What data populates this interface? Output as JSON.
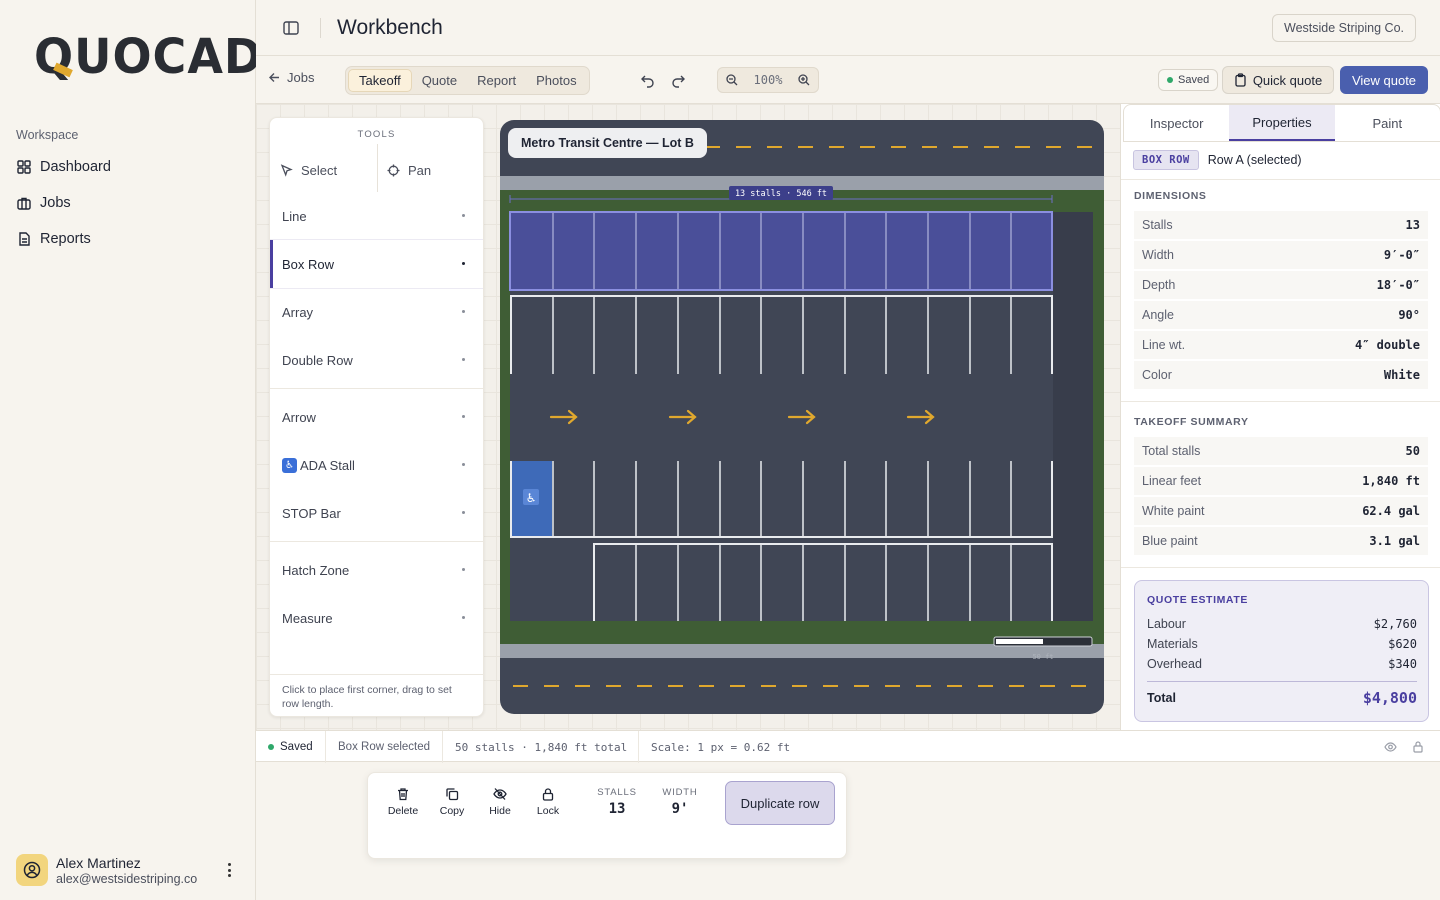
{
  "brand": {
    "logo": "QUOCAD"
  },
  "sidebar": {
    "section_label": "Workspace",
    "items": [
      {
        "label": "Dashboard",
        "icon": "grid-icon"
      },
      {
        "label": "Jobs",
        "icon": "briefcase-icon"
      },
      {
        "label": "Reports",
        "icon": "document-icon"
      }
    ],
    "user": {
      "name": "Alex Martinez",
      "email": "alex@westsidestriping.co"
    }
  },
  "header": {
    "title": "Workbench",
    "company": "Westside Striping Co."
  },
  "toolbar": {
    "back_label": "Jobs",
    "tabs": [
      {
        "label": "Takeoff",
        "active": true
      },
      {
        "label": "Quote",
        "active": false
      },
      {
        "label": "Report",
        "active": false
      },
      {
        "label": "Photos",
        "active": false
      }
    ],
    "zoom": "100%",
    "saved": "Saved",
    "quick_quote": "Quick quote",
    "view_quote": "View quote"
  },
  "tools": {
    "title": "TOOLS",
    "select": "Select",
    "pan": "Pan",
    "items": [
      "Line",
      "Box Row",
      "Array",
      "Double Row",
      "Arrow",
      "ADA Stall",
      "STOP Bar",
      "Hatch Zone",
      "Measure"
    ],
    "active": "Box Row",
    "hint": "Click to place first corner, drag to set row length."
  },
  "canvas": {
    "lot_name": "Metro Transit Centre — Lot B",
    "dimension_label": "13 stalls · 546 ft",
    "scale_label": "50 ft",
    "colors": {
      "asphalt": "#404655",
      "grass": "#3f5d35",
      "curb": "#9aa0aa",
      "lane": "#e0a82e",
      "selection": "#4a4f99",
      "ada": "#3e6ab8"
    }
  },
  "inspector": {
    "tabs": [
      {
        "label": "Inspector",
        "active": false
      },
      {
        "label": "Properties",
        "active": true
      },
      {
        "label": "Paint",
        "active": false
      }
    ],
    "badge": "BOX ROW",
    "selection": "Row A (selected)",
    "dimensions_title": "DIMENSIONS",
    "dimensions": [
      {
        "label": "Stalls",
        "value": "13"
      },
      {
        "label": "Width",
        "value": "9′-0″"
      },
      {
        "label": "Depth",
        "value": "18′-0″"
      },
      {
        "label": "Angle",
        "value": "90°"
      },
      {
        "label": "Line wt.",
        "value": "4″ double"
      },
      {
        "label": "Color",
        "value": "White"
      }
    ],
    "summary_title": "TAKEOFF SUMMARY",
    "summary": [
      {
        "label": "Total stalls",
        "value": "50"
      },
      {
        "label": "Linear feet",
        "value": "1,840 ft"
      },
      {
        "label": "White paint",
        "value": "62.4 gal"
      },
      {
        "label": "Blue paint",
        "value": "3.1 gal"
      }
    ],
    "quote": {
      "title": "QUOTE ESTIMATE",
      "rows": [
        {
          "label": "Labour",
          "value": "$2,760"
        },
        {
          "label": "Materials",
          "value": "$620"
        },
        {
          "label": "Overhead",
          "value": "$340"
        }
      ],
      "total_label": "Total",
      "total_value": "$4,800"
    }
  },
  "status": {
    "saved": "Saved",
    "selection": "Box Row selected",
    "counts": "50 stalls · 1,840 ft total",
    "scale": "Scale: 1 px = 0.62 ft"
  },
  "actions": {
    "buttons": [
      {
        "label": "Delete",
        "icon": "trash-icon"
      },
      {
        "label": "Copy",
        "icon": "copy-icon"
      },
      {
        "label": "Hide",
        "icon": "eye-off-icon"
      },
      {
        "label": "Lock",
        "icon": "lock-icon"
      }
    ],
    "stalls_label": "STALLS",
    "stalls_value": "13",
    "width_label": "WIDTH",
    "width_value": "9'",
    "duplicate": "Duplicate row"
  }
}
